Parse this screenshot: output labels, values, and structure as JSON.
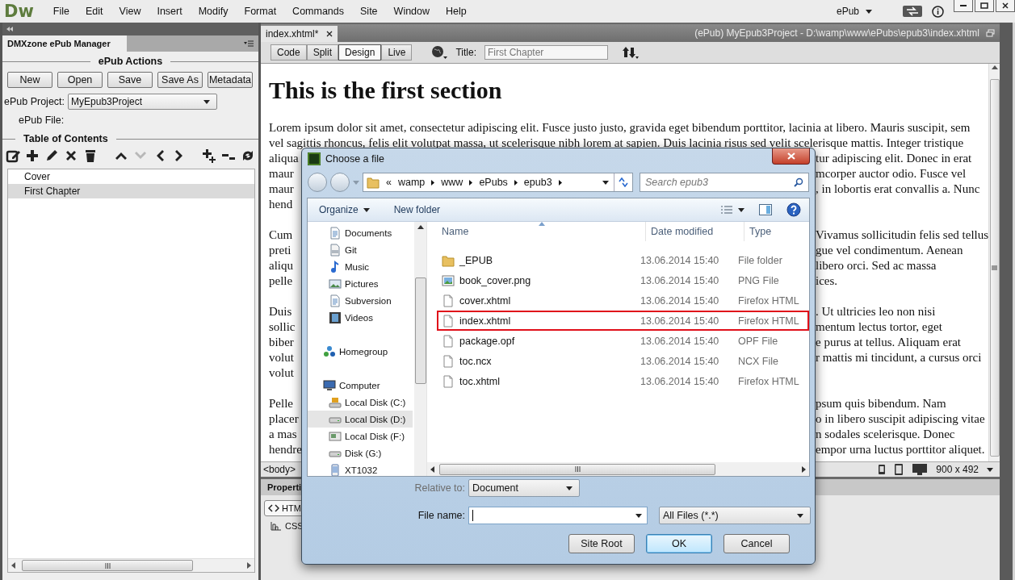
{
  "app": {
    "logo": "Dw",
    "menus": [
      "File",
      "Edit",
      "View",
      "Insert",
      "Modify",
      "Format",
      "Commands",
      "Site",
      "Window",
      "Help"
    ],
    "workspace": "ePub"
  },
  "panel": {
    "tab": "DMXzone ePub Manager",
    "actions_heading": "ePub Actions",
    "buttons": [
      "New",
      "Open",
      "Save",
      "Save As",
      "Metadata"
    ],
    "project_label": "ePub Project:",
    "project_value": "MyEpub3Project",
    "file_label": "ePub File:",
    "toc_heading": "Table of Contents",
    "toc_tools": [
      {
        "kind": "new",
        "disabled": false
      },
      {
        "kind": "add",
        "disabled": false
      },
      {
        "kind": "edit",
        "disabled": false
      },
      {
        "kind": "delete",
        "disabled": false
      },
      {
        "kind": "trash",
        "disabled": false
      },
      {
        "kind": "up",
        "disabled": false
      },
      {
        "kind": "down",
        "disabled": true
      },
      {
        "kind": "left",
        "disabled": false
      },
      {
        "kind": "right",
        "disabled": false
      },
      {
        "kind": "add-child",
        "disabled": false
      },
      {
        "kind": "remove",
        "disabled": false
      },
      {
        "kind": "refresh",
        "disabled": false
      }
    ],
    "toc_items": [
      {
        "label": "Cover",
        "selected": false
      },
      {
        "label": "First Chapter",
        "selected": true
      }
    ]
  },
  "document": {
    "tab": "index.xhtml*",
    "path": "(ePub) MyEpub3Project - D:\\wamp\\www\\ePubs\\epub3\\index.xhtml",
    "views": [
      {
        "label": "Code",
        "selected": false
      },
      {
        "label": "Split",
        "selected": false
      },
      {
        "label": "Design",
        "selected": true
      },
      {
        "label": "Live",
        "selected": false
      }
    ],
    "title_label": "Title:",
    "title_value": "First Chapter",
    "heading": "This is the first section",
    "paragraphs": [
      [
        {
          "left": "Lorem ipsum dolor sit amet, consectetur adipiscing elit. Fusce justo justo, gravida eget bibendum porttitor, lacinia at libero. Mauris suscipit, sem"
        },
        {
          "left": "vel sagittis rhoncus, felis elit volutpat massa, ut scelerisque nibh lorem at sapien. Duis lacinia risus sed velit scelerisque mattis. Integer tristique"
        },
        {
          "left": "aliqua",
          "right": "tur adipiscing elit. Donec in erat"
        },
        {
          "left": "maur",
          "right": "mcorper auctor odio. Fusce vel"
        },
        {
          "left": "maur",
          "right": ", in lobortis erat convallis a. Nunc"
        },
        {
          "left": "hend"
        }
      ],
      [
        {
          "left": "Cum",
          "right": "Vivamus sollicitudin felis sed tellus"
        },
        {
          "left": "preti",
          "right": "gue vel condimentum. Aenean"
        },
        {
          "left": "aliqu",
          "right": "libero orci. Sed ac massa"
        },
        {
          "left": "pelle",
          "right": "ices."
        }
      ],
      [
        {
          "left": "Duis",
          "right": ". Ut ultricies leo non nisi"
        },
        {
          "left": "sollic",
          "right": "mentum lectus tortor, eget"
        },
        {
          "left": "biber",
          "right": "e purus at tellus. Aliquam erat"
        },
        {
          "left": "volut",
          "right": "r mattis mi tincidunt, a cursus orci"
        },
        {
          "left": "volut"
        }
      ],
      [
        {
          "left": "Pelle",
          "right": "psum quis bibendum. Nam"
        },
        {
          "left": "placer",
          "right": "o in libero suscipit adipiscing vitae"
        },
        {
          "left": "a mas",
          "right": "n sodales scelerisque. Donec"
        },
        {
          "left": "hendre",
          "right": "empor urna luctus porttitor aliquet."
        }
      ]
    ],
    "status_tag": "<body>",
    "size": "900 x 492"
  },
  "properties": {
    "title": "Properti",
    "html_button": "HTM",
    "css_button": "CSS"
  },
  "dialog": {
    "title": "Choose a file",
    "overflow": "«",
    "breadcrumb": [
      "wamp",
      "www",
      "ePubs",
      "epub3"
    ],
    "search_placeholder": "Search epub3",
    "toolbar": [
      "Organize",
      "New folder"
    ],
    "nav": [
      {
        "children": [
          {
            "label": "Documents",
            "kind": "documents",
            "selected": false
          },
          {
            "label": "Git",
            "kind": "git",
            "selected": false
          },
          {
            "label": "Music",
            "kind": "music",
            "selected": false
          },
          {
            "label": "Pictures",
            "kind": "pictures",
            "selected": false
          },
          {
            "label": "Subversion",
            "kind": "documents",
            "selected": false
          },
          {
            "label": "Videos",
            "kind": "videos",
            "selected": false
          }
        ]
      },
      {
        "label": "Homegroup",
        "kind": "homegroup",
        "selected": false
      },
      {
        "label": "Computer",
        "kind": "computer",
        "selected": false,
        "children": [
          {
            "label": "Local Disk (C:)",
            "kind": "system-disk",
            "selected": false
          },
          {
            "label": "Local Disk (D:)",
            "kind": "disk",
            "selected": true
          },
          {
            "label": "Local Disk (F:)",
            "kind": "disk32",
            "selected": false
          },
          {
            "label": "Disk (G:)",
            "kind": "disk",
            "selected": false
          },
          {
            "label": "XT1032",
            "kind": "phone",
            "selected": false
          }
        ]
      }
    ],
    "columns": [
      "Name",
      "Date modified",
      "Type"
    ],
    "files": [
      {
        "name": "_EPUB",
        "kind": "folder",
        "date": "13.06.2014 15:40",
        "type": "File folder",
        "outlined": false
      },
      {
        "name": "book_cover.png",
        "kind": "image",
        "date": "13.06.2014 15:40",
        "type": "PNG File",
        "outlined": false
      },
      {
        "name": "cover.xhtml",
        "kind": "file",
        "date": "13.06.2014 15:40",
        "type": "Firefox HTML",
        "outlined": false
      },
      {
        "name": "index.xhtml",
        "kind": "file",
        "date": "13.06.2014 15:40",
        "type": "Firefox HTML",
        "outlined": true
      },
      {
        "name": "package.opf",
        "kind": "file",
        "date": "13.06.2014 15:40",
        "type": "OPF File",
        "outlined": false
      },
      {
        "name": "toc.ncx",
        "kind": "file",
        "date": "13.06.2014 15:40",
        "type": "NCX File",
        "outlined": false
      },
      {
        "name": "toc.xhtml",
        "kind": "file",
        "date": "13.06.2014 15:40",
        "type": "Firefox HTML",
        "outlined": false
      }
    ],
    "relative_label": "Relative to:",
    "relative_value": "Document",
    "filename_label": "File name:",
    "filter": "All Files (*.*)",
    "buttons": [
      {
        "label": "Site Root",
        "default": false
      },
      {
        "label": "OK",
        "default": true
      },
      {
        "label": "Cancel",
        "default": false
      }
    ]
  }
}
